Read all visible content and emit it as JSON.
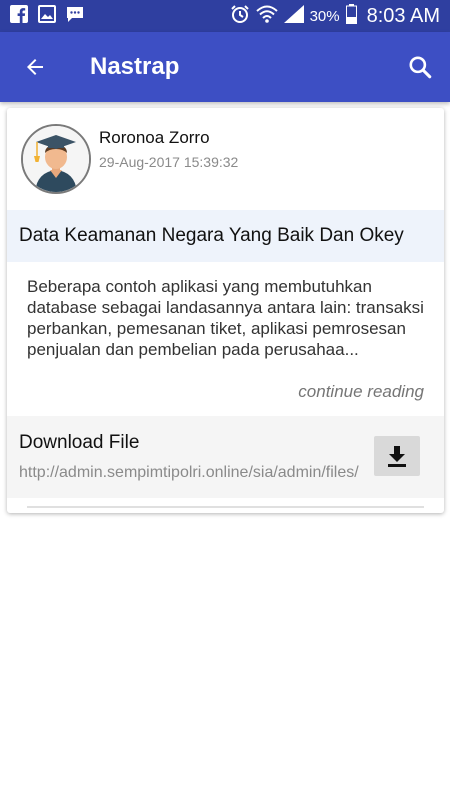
{
  "status_bar": {
    "battery_percent": "30%",
    "time": "8:03 AM",
    "icons": [
      "facebook-icon",
      "gallery-icon",
      "message-icon",
      "alarm-icon",
      "wifi-icon",
      "signal-icon",
      "battery-icon"
    ]
  },
  "app_bar": {
    "title": "Nastrap",
    "back_icon": "arrow-back-icon",
    "search_icon": "search-icon"
  },
  "post": {
    "author_name": "Roronoa Zorro",
    "date": "29-Aug-2017 15:39:32",
    "headline": "Data Keamanan Negara Yang Baik Dan Okey",
    "excerpt": "Beberapa contoh aplikasi yang membutuhkan database sebagai landasannya antara lain: transaksi perbankan, pemesanan tiket, aplikasi pemrosesan penjualan dan pembelian pada perusahaa...",
    "continue_label": "continue reading"
  },
  "download": {
    "title": "Download File",
    "url": "http://admin.sempimtipolri.online/sia/admin/files/",
    "icon": "download-icon"
  },
  "colors": {
    "status_bar": "#2f3fa0",
    "app_bar": "#3d4fc4",
    "headline_bg": "#eef3fb",
    "download_bg": "#f5f5f5"
  }
}
